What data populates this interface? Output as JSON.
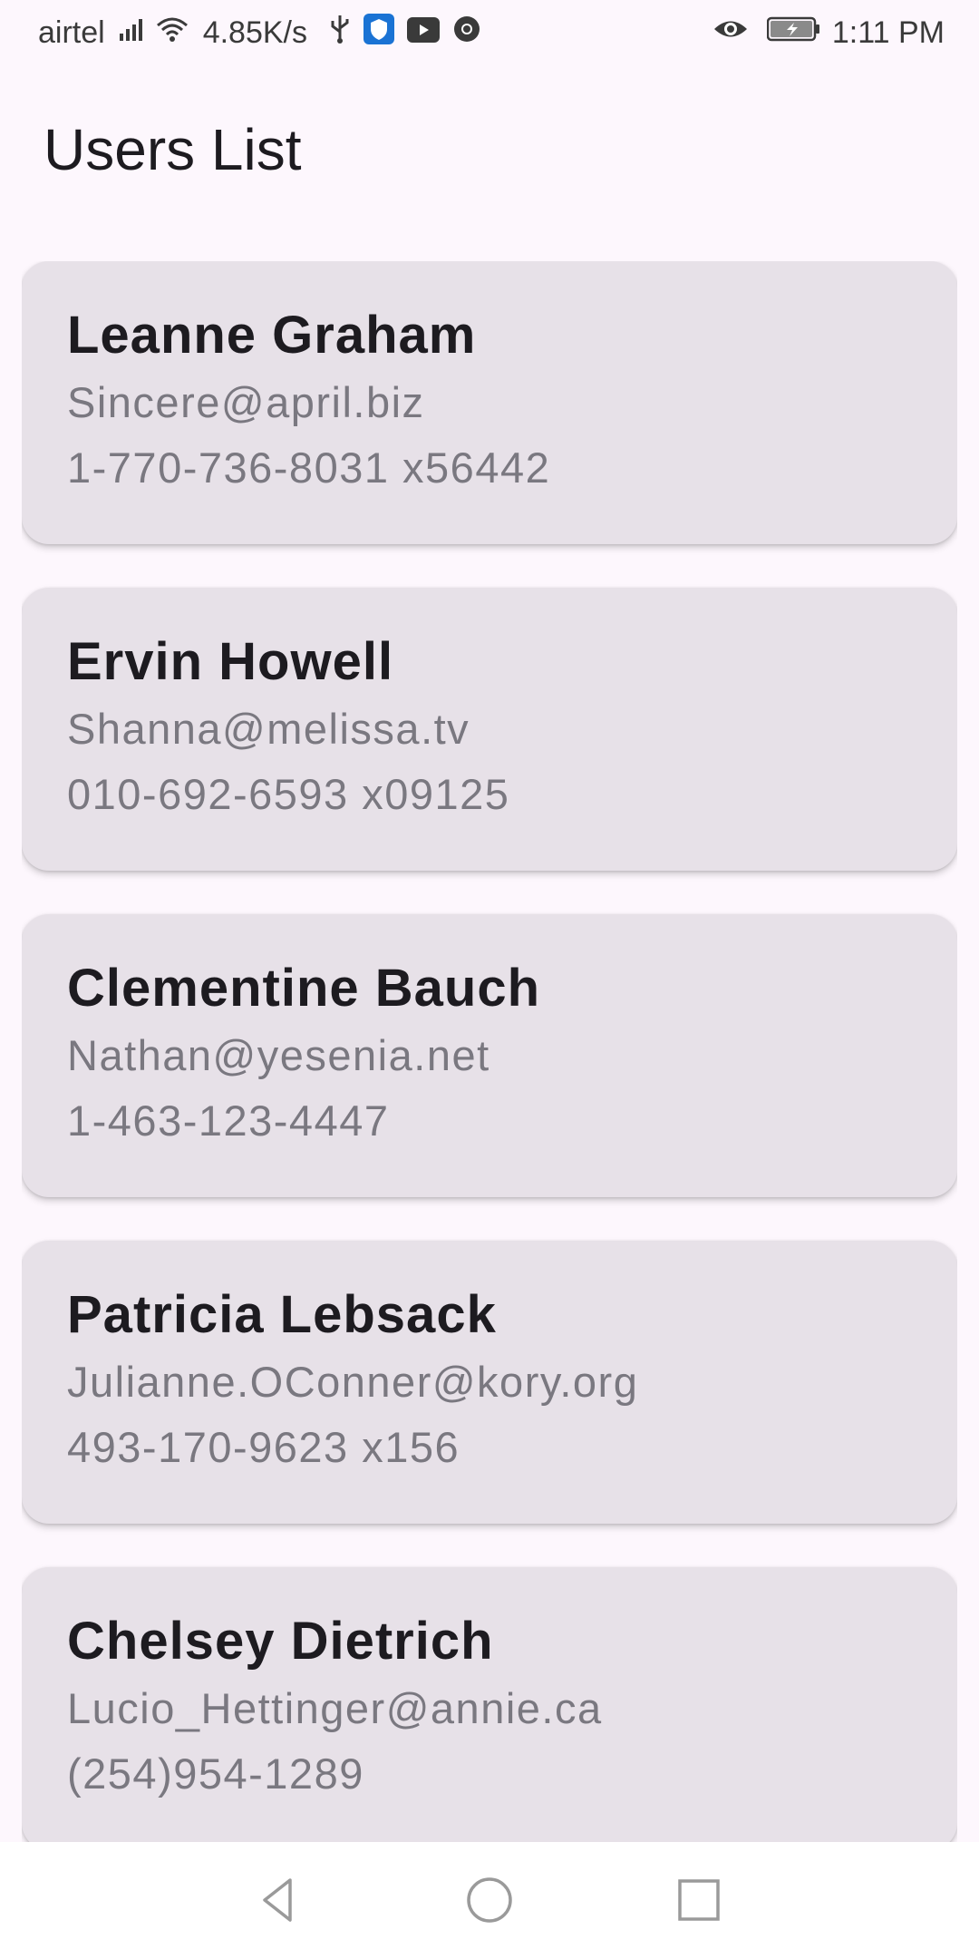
{
  "status_bar": {
    "carrier": "airtel",
    "network_speed": "4.85K/s",
    "time": "1:11 PM",
    "icons": [
      "signal-icon",
      "wifi-icon",
      "usb-icon",
      "shield-app-icon",
      "youtube-icon",
      "chrome-icon",
      "eye-icon",
      "battery-icon"
    ]
  },
  "header": {
    "title": "Users List"
  },
  "users": [
    {
      "name": "Leanne Graham",
      "email": "Sincere@april.biz",
      "phone": "1-770-736-8031 x56442"
    },
    {
      "name": "Ervin Howell",
      "email": "Shanna@melissa.tv",
      "phone": "010-692-6593 x09125"
    },
    {
      "name": "Clementine Bauch",
      "email": "Nathan@yesenia.net",
      "phone": "1-463-123-4447"
    },
    {
      "name": "Patricia Lebsack",
      "email": "Julianne.OConner@kory.org",
      "phone": "493-170-9623 x156"
    },
    {
      "name": "Chelsey Dietrich",
      "email": "Lucio_Hettinger@annie.ca",
      "phone": "(254)954-1289"
    }
  ],
  "nav_bar": {
    "icons": [
      "back-icon",
      "home-icon",
      "recents-icon"
    ]
  },
  "colors": {
    "background": "#fdf7fd",
    "card": "#e7e1e8",
    "name_text": "#1d1b20",
    "secondary_text": "#7a7880"
  }
}
